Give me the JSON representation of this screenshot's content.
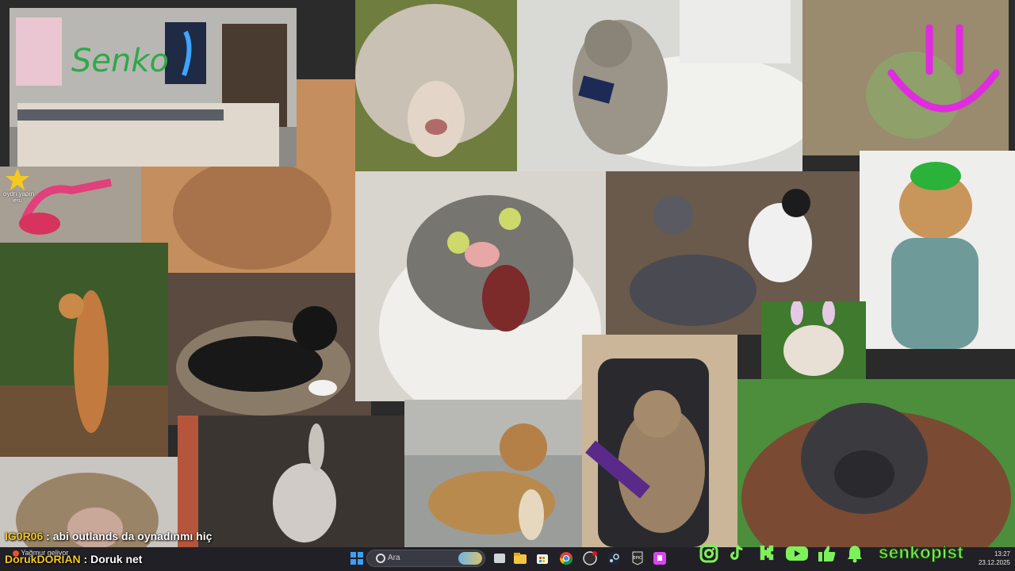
{
  "chat": {
    "messages": [
      {
        "user": "IG0R06",
        "sep": " : ",
        "text": "abi outlands da oynadınmı hiç"
      },
      {
        "user": "DorukDORIAN",
        "sep": " : ",
        "text": "Doruk net"
      }
    ]
  },
  "room_tile": {
    "wall_text": "Senko"
  },
  "stream_alert": {
    "text_line1": "oydn yapın",
    "text_line2": "ieru"
  },
  "taskbar": {
    "weather_text": "Yağmur geliyor",
    "search_placeholder": "Ara",
    "time": "13:27",
    "date": "23.12.2025",
    "app_icons": [
      "windows-start-icon",
      "task-view-icon",
      "file-explorer-icon",
      "store-icon",
      "chrome-icon",
      "obs-icon",
      "steam-icon",
      "epic-games-icon",
      "twitch-icon"
    ]
  },
  "social_bar": {
    "icons": [
      "instagram-icon",
      "tiktok-icon",
      "kick-icon",
      "youtube-icon",
      "like-icon",
      "notification-bell-icon"
    ],
    "handle": "senkopist",
    "color": "#7df15a"
  }
}
